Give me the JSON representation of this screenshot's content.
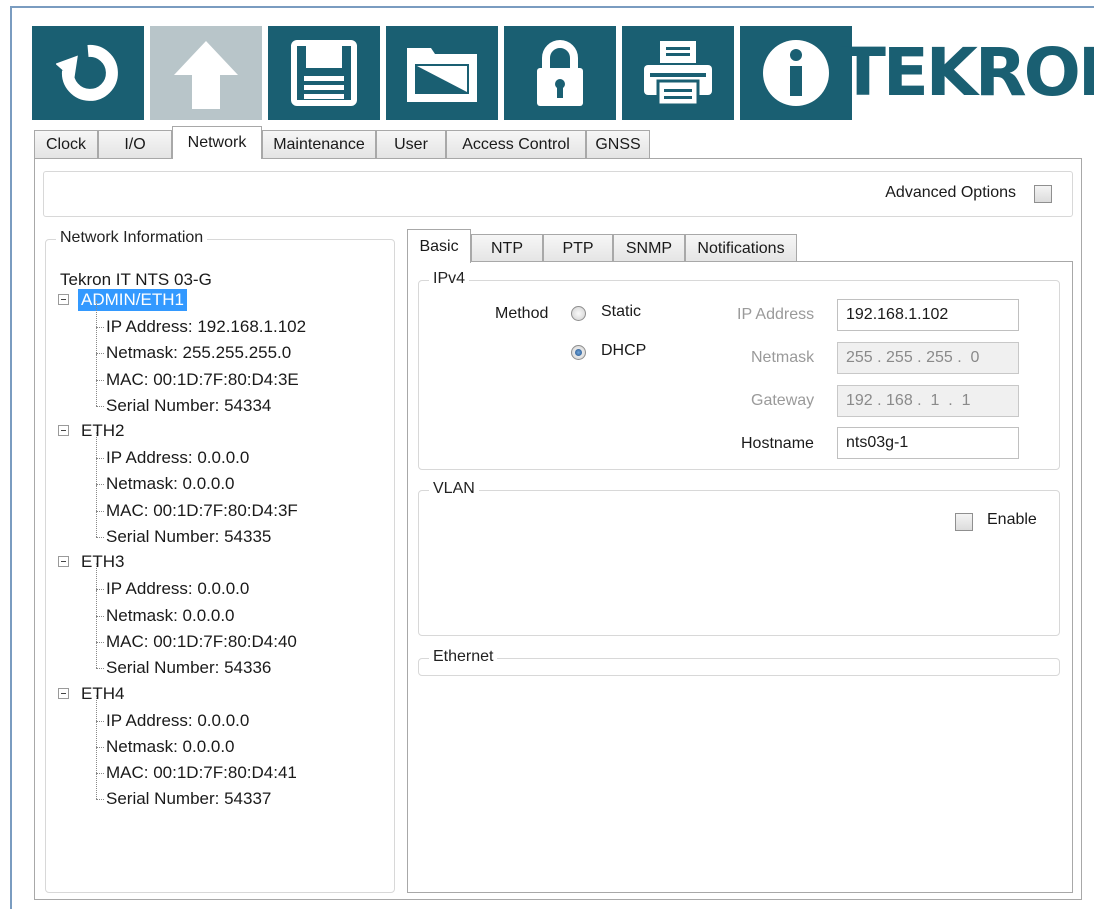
{
  "toolbar": {
    "buttons": [
      {
        "name": "refresh-icon",
        "enabled": true
      },
      {
        "name": "upload-arrow-icon",
        "enabled": false
      },
      {
        "name": "save-disk-icon",
        "enabled": true
      },
      {
        "name": "folder-open-icon",
        "enabled": true
      },
      {
        "name": "lock-icon",
        "enabled": true
      },
      {
        "name": "printer-icon",
        "enabled": true
      },
      {
        "name": "info-icon",
        "enabled": true
      }
    ],
    "brand": "TEKRON",
    "brand_color": "#1a5f72",
    "disabled_color": "#b8c5c9"
  },
  "tabs": {
    "clock": "Clock",
    "io": "I/O",
    "network": "Network",
    "maintenance": "Maintenance",
    "user": "User",
    "access_control": "Access Control",
    "gnss": "GNSS",
    "active": "Network"
  },
  "advanced_options": {
    "label": "Advanced Options",
    "checked": false
  },
  "network_info": {
    "title": "Network Information",
    "device": "Tekron IT NTS 03-G",
    "interfaces": [
      {
        "name": "ADMIN/ETH1",
        "selected": true,
        "ip": "IP Address: 192.168.1.102",
        "netmask": "Netmask: 255.255.255.0",
        "mac": "MAC: 00:1D:7F:80:D4:3E",
        "serial": "Serial Number: 54334"
      },
      {
        "name": "ETH2",
        "selected": false,
        "ip": "IP Address: 0.0.0.0",
        "netmask": "Netmask: 0.0.0.0",
        "mac": "MAC: 00:1D:7F:80:D4:3F",
        "serial": "Serial Number: 54335"
      },
      {
        "name": "ETH3",
        "selected": false,
        "ip": "IP Address: 0.0.0.0",
        "netmask": "Netmask: 0.0.0.0",
        "mac": "MAC: 00:1D:7F:80:D4:40",
        "serial": "Serial Number: 54336"
      },
      {
        "name": "ETH4",
        "selected": false,
        "ip": "IP Address: 0.0.0.0",
        "netmask": "Netmask: 0.0.0.0",
        "mac": "MAC: 00:1D:7F:80:D4:41",
        "serial": "Serial Number: 54337"
      }
    ]
  },
  "sub_tabs": {
    "basic": "Basic",
    "ntp": "NTP",
    "ptp": "PTP",
    "snmp": "SNMP",
    "notifications": "Notifications",
    "active": "Basic"
  },
  "ipv4": {
    "title": "IPv4",
    "method_label": "Method",
    "static_label": "Static",
    "dhcp_label": "DHCP",
    "selected_method": "DHCP",
    "ip_label": "IP Address",
    "ip_value": "192.168.1.102",
    "netmask_label": "Netmask",
    "netmask_value": "255 . 255 . 255 .  0",
    "gateway_label": "Gateway",
    "gateway_value": "192 . 168 .  1  .  1",
    "hostname_label": "Hostname",
    "hostname_value": "nts03g-1"
  },
  "vlan": {
    "title": "VLAN",
    "enable_label": "Enable",
    "enabled": false
  },
  "ethernet": {
    "title": "Ethernet"
  }
}
